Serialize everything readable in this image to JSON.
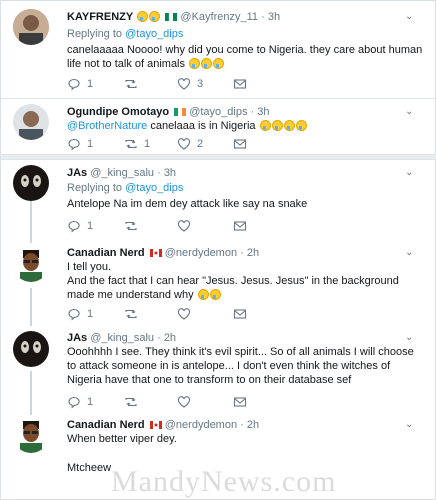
{
  "tweets": [
    {
      "name": "KAYFRENZY",
      "handle": "@Kayfrenzy_11",
      "time": "3h",
      "replying_prefix": "Replying to",
      "replying_to": "@tayo_dips",
      "text": "canelaaaaa Noooo! why did you come to Nigeria. they care about human life not to talk of animals",
      "reply_count": "1",
      "retweet_count": "",
      "like_count": "3"
    },
    {
      "name": "Ogundipe Omotayo",
      "handle": "@tayo_dips",
      "time": "3h",
      "mention": "@BrotherNature",
      "text": "canelaaa is in Nigeria",
      "reply_count": "1",
      "retweet_count": "1",
      "like_count": "2"
    },
    {
      "name": "JAs",
      "handle": "@_king_salu",
      "time": "3h",
      "replying_prefix": "Replying to",
      "replying_to": "@tayo_dips",
      "text": "Antelope Na im dem dey attack like say na snake",
      "reply_count": "1",
      "retweet_count": "",
      "like_count": ""
    },
    {
      "name": "Canadian Nerd",
      "handle": "@nerdydemon",
      "time": "2h",
      "text_line1": "I tell you.",
      "text_line2": "And the fact that I can hear \"Jesus. Jesus. Jesus\" in the background made me understand why",
      "reply_count": "1",
      "retweet_count": "",
      "like_count": ""
    },
    {
      "name": "JAs",
      "handle": "@_king_salu",
      "time": "2h",
      "text": "Ooohhhh I see. They think it's evil spirit... So of all animals I will choose to attack someone in is antelope... I don't even think the witches of Nigeria have that one to transform to on their database sef",
      "reply_count": "1",
      "retweet_count": "",
      "like_count": ""
    },
    {
      "name": "Canadian Nerd",
      "handle": "@nerdydemon",
      "time": "2h",
      "text_line1": "When better viper dey.",
      "text_line2": "Mtcheew"
    }
  ],
  "watermark": "MandyNews.com",
  "colors": {
    "link": "#1b95e0",
    "meta": "#657786",
    "nigeria_green": "#008751",
    "ireland_orange": "#ff883e",
    "canada_red": "#d52b1e"
  }
}
